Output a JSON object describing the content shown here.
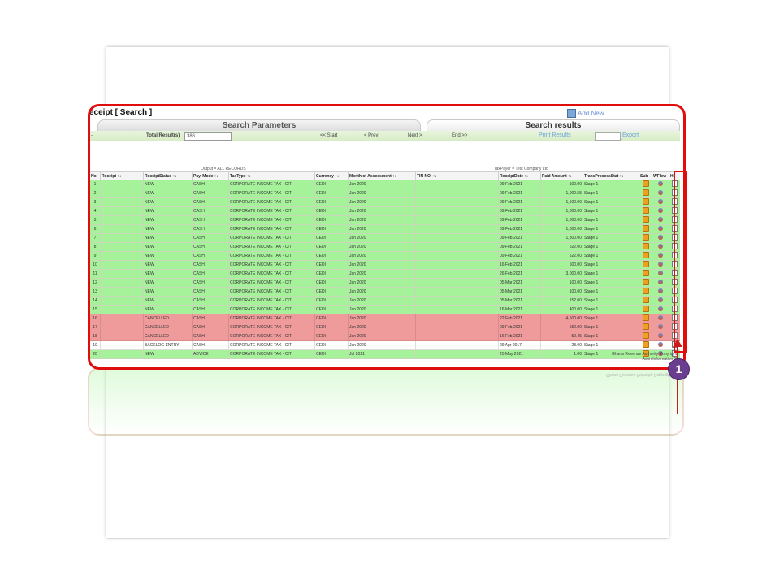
{
  "header": {
    "page_title": "eceipt [ Search ]",
    "add_new_label": "Add New"
  },
  "tabs": {
    "params_label": "Search Parameters",
    "results_label": "Search results"
  },
  "navbar": {
    "collapse_symbol": "-",
    "total_label": "Total Result(s)",
    "total_value": "386",
    "start_label": "<< Start",
    "prev_label": "< Prev",
    "next_label": "Next >",
    "end_label": "End >>",
    "print_label": "Print Results",
    "export_label": "Export"
  },
  "captions": {
    "output": "Output = ALL RECORDS",
    "taxpayer": "TaxPayer = Test Company Ltd"
  },
  "columns": [
    "No.",
    "Receipt ↑↓",
    "ReceiptStatus ↑↓",
    "Pay. Mode ↑↓",
    "TaxType ↑↓",
    "Currency ↑↓",
    "Month of Assessment ↑↓",
    "TIN NO. ↑↓",
    "ReceiptDate ↑↓",
    "Paid Amount ↑↓",
    "TransProcessStat ↑↓",
    "Sub",
    "WFlow",
    "Hi"
  ],
  "rows": [
    {
      "no": "1",
      "status": "NEW",
      "mode": "CASH",
      "tax": "CORPORATE INCOME TAX - CIT",
      "cur": "CEDI",
      "month": "Jan 2020",
      "date": "09 Feb 2021",
      "amount": "100.00",
      "stage": "Stage 1",
      "color": "green"
    },
    {
      "no": "2",
      "status": "NEW",
      "mode": "CASH",
      "tax": "CORPORATE INCOME TAX - CIT",
      "cur": "CEDI",
      "month": "Jan 2020",
      "date": "09 Feb 2021",
      "amount": "1,000.55",
      "stage": "Stage 1",
      "color": "green"
    },
    {
      "no": "3",
      "status": "NEW",
      "mode": "CASH",
      "tax": "CORPORATE INCOME TAX - CIT",
      "cur": "CEDI",
      "month": "Jan 2020",
      "date": "09 Feb 2021",
      "amount": "1,500.00",
      "stage": "Stage 1",
      "color": "green"
    },
    {
      "no": "4",
      "status": "NEW",
      "mode": "CASH",
      "tax": "CORPORATE INCOME TAX - CIT",
      "cur": "CEDI",
      "month": "Jan 2020",
      "date": "09 Feb 2021",
      "amount": "1,800.00",
      "stage": "Stage 1",
      "color": "green"
    },
    {
      "no": "5",
      "status": "NEW",
      "mode": "CASH",
      "tax": "CORPORATE INCOME TAX - CIT",
      "cur": "CEDI",
      "month": "Jan 2020",
      "date": "09 Feb 2021",
      "amount": "1,800.00",
      "stage": "Stage 1",
      "color": "green"
    },
    {
      "no": "6",
      "status": "NEW",
      "mode": "CASH",
      "tax": "CORPORATE INCOME TAX - CIT",
      "cur": "CEDI",
      "month": "Jan 2020",
      "date": "09 Feb 2021",
      "amount": "1,800.00",
      "stage": "Stage 1",
      "color": "green"
    },
    {
      "no": "7",
      "status": "NEW",
      "mode": "CASH",
      "tax": "CORPORATE INCOME TAX - CIT",
      "cur": "CEDI",
      "month": "Jan 2020",
      "date": "09 Feb 2021",
      "amount": "1,800.00",
      "stage": "Stage 1",
      "color": "green"
    },
    {
      "no": "8",
      "status": "NEW",
      "mode": "CASH",
      "tax": "CORPORATE INCOME TAX - CIT",
      "cur": "CEDI",
      "month": "Jan 2020",
      "date": "09 Feb 2021",
      "amount": "522.00",
      "stage": "Stage 1",
      "color": "green"
    },
    {
      "no": "9",
      "status": "NEW",
      "mode": "CASH",
      "tax": "CORPORATE INCOME TAX - CIT",
      "cur": "CEDI",
      "month": "Jan 2020",
      "date": "09 Feb 2021",
      "amount": "522.00",
      "stage": "Stage 1",
      "color": "green"
    },
    {
      "no": "10",
      "status": "NEW",
      "mode": "CASH",
      "tax": "CORPORATE INCOME TAX - CIT",
      "cur": "CEDI",
      "month": "Jan 2020",
      "date": "16 Feb 2021",
      "amount": "500.00",
      "stage": "Stage 1",
      "color": "green"
    },
    {
      "no": "11",
      "status": "NEW",
      "mode": "CASH",
      "tax": "CORPORATE INCOME TAX - CIT",
      "cur": "CEDI",
      "month": "Jan 2020",
      "date": "26 Feb 2021",
      "amount": "3,000.00",
      "stage": "Stage 1",
      "color": "green"
    },
    {
      "no": "12",
      "status": "NEW",
      "mode": "CASH",
      "tax": "CORPORATE INCOME TAX - CIT",
      "cur": "CEDI",
      "month": "Jan 2020",
      "date": "05 Mar 2021",
      "amount": "100.00",
      "stage": "Stage 1",
      "color": "green"
    },
    {
      "no": "13",
      "status": "NEW",
      "mode": "CASH",
      "tax": "CORPORATE INCOME TAX - CIT",
      "cur": "CEDI",
      "month": "Jan 2020",
      "date": "05 Mar 2021",
      "amount": "100.00",
      "stage": "Stage 1",
      "color": "green"
    },
    {
      "no": "14",
      "status": "NEW",
      "mode": "CASH",
      "tax": "CORPORATE INCOME TAX - CIT",
      "cur": "CEDI",
      "month": "Jan 2020",
      "date": "05 Mar 2021",
      "amount": "152.00",
      "stage": "Stage 1",
      "color": "green"
    },
    {
      "no": "15",
      "status": "NEW",
      "mode": "CASH",
      "tax": "CORPORATE INCOME TAX - CIT",
      "cur": "CEDI",
      "month": "Jan 2020",
      "date": "16 Mar 2021",
      "amount": "400.00",
      "stage": "Stage 1",
      "color": "green"
    },
    {
      "no": "16",
      "status": "CANCELLED",
      "mode": "CASH",
      "tax": "CORPORATE INCOME TAX - CIT",
      "cur": "CEDI",
      "month": "Jan 2020",
      "date": "22 Feb 2021",
      "amount": "4,500.00",
      "stage": "Stage 1",
      "color": "red"
    },
    {
      "no": "17",
      "status": "CANCELLED",
      "mode": "CASH",
      "tax": "CORPORATE INCOME TAX - CIT",
      "cur": "CEDI",
      "month": "Jan 2020",
      "date": "09 Feb 2021",
      "amount": "552.00",
      "stage": "Stage 1",
      "color": "red"
    },
    {
      "no": "18",
      "status": "CANCELLED",
      "mode": "CASH",
      "tax": "CORPORATE INCOME TAX - CIT",
      "cur": "CEDI",
      "month": "Jan 2020",
      "date": "16 Feb 2021",
      "amount": "59.45",
      "stage": "Stage 1",
      "color": "red"
    },
    {
      "no": "19",
      "status": "BACKLOG ENTRY",
      "mode": "CASH",
      "tax": "CORPORATE INCOME TAX - CIT",
      "cur": "CEDI",
      "month": "Jan 2020",
      "date": "29 Apr 2017",
      "amount": "28.00",
      "stage": "Stage 1",
      "color": "white"
    },
    {
      "no": "20",
      "status": "NEW",
      "mode": "ADVICE",
      "tax": "CORPORATE INCOME TAX - CIT",
      "cur": "CEDI",
      "month": "Jul 2021",
      "date": "25 May 2021",
      "amount": "1.00",
      "stage": "Stage 1",
      "color": "green"
    }
  ],
  "footer": {
    "line1": "Ghana Revenue Authority Copyright",
    "line2": "Axon Information S"
  },
  "annotation": {
    "badge_number": "1"
  },
  "colors": {
    "highlight": "#e00d0d",
    "row_green": "#a6f29b",
    "row_red": "#f09b9b",
    "badge": "#6a3d8f"
  },
  "icons": {
    "sub": "document-stack-icon",
    "wflow": "workflow-person-icon",
    "hi": "history-doc-icon",
    "add_new": "add-document-icon"
  }
}
